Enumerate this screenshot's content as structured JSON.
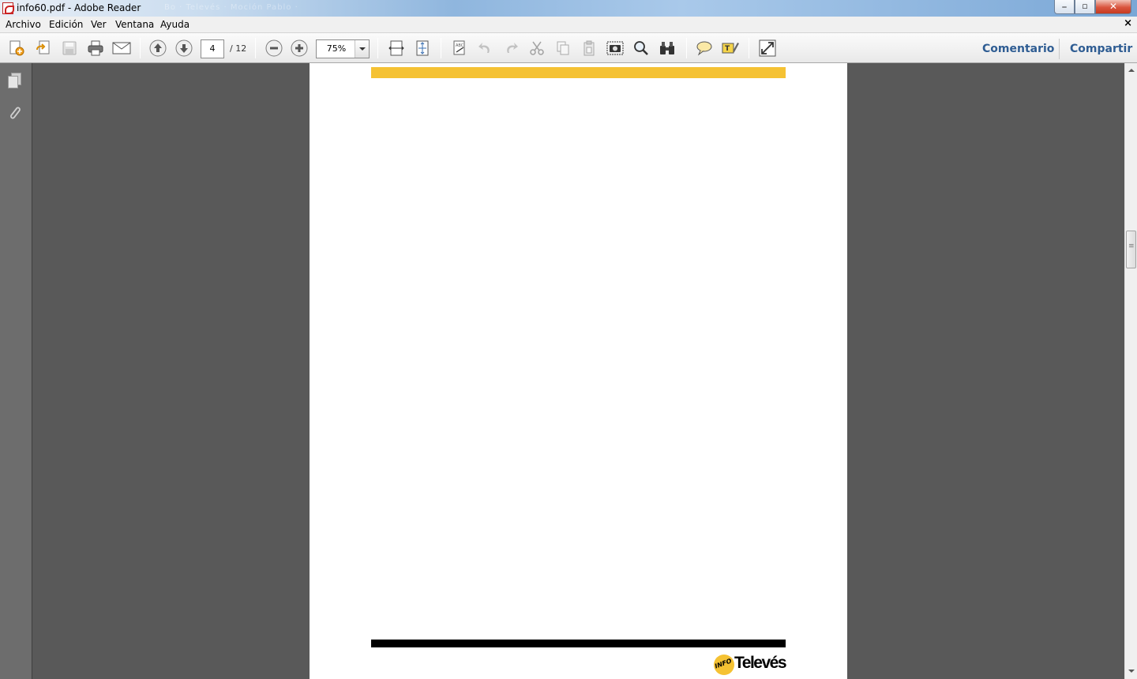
{
  "window": {
    "title": "info60.pdf - Adobe Reader",
    "ghost_text": "Bo · Televés · Moción Pablo ·",
    "min_glyph": "_",
    "max_glyph": "▫",
    "close_glyph": "✕"
  },
  "menu": {
    "items": [
      {
        "label": "Archivo"
      },
      {
        "label": "Edición"
      },
      {
        "label": "Ver"
      },
      {
        "label": "Ventana"
      },
      {
        "label": "Ayuda"
      }
    ],
    "close_doc_glyph": "×"
  },
  "toolbar": {
    "page_current": "4",
    "page_total": "/ 12",
    "zoom_value": "75%",
    "comment_label": "Comentario",
    "share_label": "Compartir"
  },
  "document": {
    "logo_prefix": "INFO",
    "logo_brand": "Televés",
    "colors": {
      "accent_yellow": "#f5c233",
      "footer_black": "#000000"
    }
  }
}
